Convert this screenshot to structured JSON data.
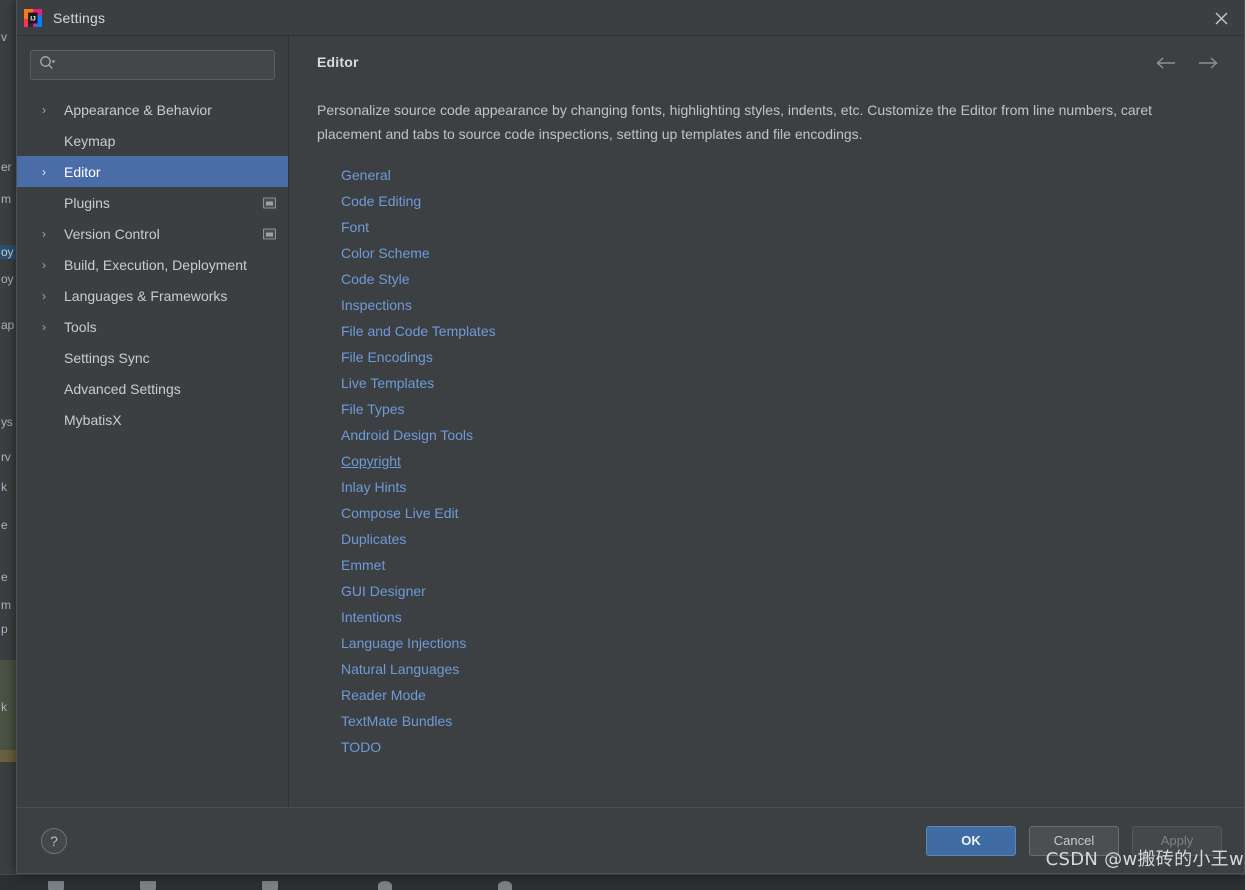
{
  "window": {
    "title": "Settings",
    "app_icon": "intellij-idea-logo",
    "close_icon": "close-icon"
  },
  "search": {
    "value": "",
    "placeholder": "",
    "icon": "search-icon"
  },
  "sidebar": {
    "items": [
      {
        "label": "Appearance & Behavior",
        "expandable": true,
        "selected": false,
        "badge": false
      },
      {
        "label": "Keymap",
        "expandable": false,
        "selected": false,
        "badge": false
      },
      {
        "label": "Editor",
        "expandable": true,
        "selected": true,
        "badge": false
      },
      {
        "label": "Plugins",
        "expandable": false,
        "selected": false,
        "badge": true
      },
      {
        "label": "Version Control",
        "expandable": true,
        "selected": false,
        "badge": true
      },
      {
        "label": "Build, Execution, Deployment",
        "expandable": true,
        "selected": false,
        "badge": false
      },
      {
        "label": "Languages & Frameworks",
        "expandable": true,
        "selected": false,
        "badge": false
      },
      {
        "label": "Tools",
        "expandable": true,
        "selected": false,
        "badge": false
      },
      {
        "label": "Settings Sync",
        "expandable": false,
        "selected": false,
        "badge": false
      },
      {
        "label": "Advanced Settings",
        "expandable": false,
        "selected": false,
        "badge": false
      },
      {
        "label": "MybatisX",
        "expandable": false,
        "selected": false,
        "badge": false
      }
    ],
    "chevron_icon": "chevron-right-icon",
    "badge_icon": "window-badge-icon"
  },
  "content": {
    "title": "Editor",
    "description": "Personalize source code appearance by changing fonts, highlighting styles, indents, etc. Customize the Editor from line numbers, caret placement and tabs to source code inspections, setting up templates and file encodings.",
    "nav": {
      "back_icon": "arrow-left-icon",
      "forward_icon": "arrow-right-icon"
    },
    "links": [
      {
        "label": "General",
        "hovered": false
      },
      {
        "label": "Code Editing",
        "hovered": false
      },
      {
        "label": "Font",
        "hovered": false
      },
      {
        "label": "Color Scheme",
        "hovered": false
      },
      {
        "label": "Code Style",
        "hovered": false
      },
      {
        "label": "Inspections",
        "hovered": false
      },
      {
        "label": "File and Code Templates",
        "hovered": false
      },
      {
        "label": "File Encodings",
        "hovered": false
      },
      {
        "label": "Live Templates",
        "hovered": false
      },
      {
        "label": "File Types",
        "hovered": false
      },
      {
        "label": "Android Design Tools",
        "hovered": false
      },
      {
        "label": "Copyright",
        "hovered": true
      },
      {
        "label": "Inlay Hints",
        "hovered": false
      },
      {
        "label": "Compose Live Edit",
        "hovered": false
      },
      {
        "label": "Duplicates",
        "hovered": false
      },
      {
        "label": "Emmet",
        "hovered": false
      },
      {
        "label": "GUI Designer",
        "hovered": false
      },
      {
        "label": "Intentions",
        "hovered": false
      },
      {
        "label": "Language Injections",
        "hovered": false
      },
      {
        "label": "Natural Languages",
        "hovered": false
      },
      {
        "label": "Reader Mode",
        "hovered": false
      },
      {
        "label": "TextMate Bundles",
        "hovered": false
      },
      {
        "label": "TODO",
        "hovered": false
      }
    ]
  },
  "footer": {
    "help_label": "?",
    "help_icon": "help-icon",
    "ok_label": "OK",
    "cancel_label": "Cancel",
    "apply_label": "Apply",
    "apply_disabled": true
  },
  "watermark": "CSDN @w搬砖的小王w",
  "background_ide": {
    "partial_lines": [
      "v",
      "er",
      "m",
      "oy",
      "oy",
      "ap",
      "ys",
      "rv",
      "k",
      "oe",
      "e",
      "m",
      "p",
      "k"
    ]
  },
  "colors": {
    "accent_selection": "#4a6da8",
    "link": "#6f9ad8",
    "ok_button": "#3f6ca3",
    "dialog_bg": "#3c4043",
    "sidebar_bg": "#3c3f41"
  }
}
